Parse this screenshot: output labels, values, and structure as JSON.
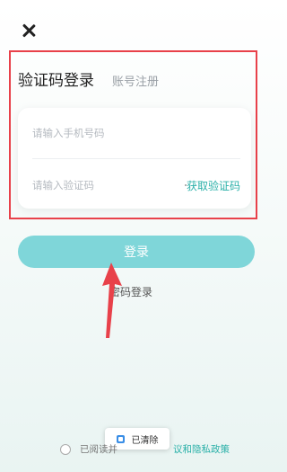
{
  "tabs": {
    "active": "验证码登录",
    "inactive": "账号注册"
  },
  "form": {
    "phone_placeholder": "请输入手机号码",
    "code_placeholder": "请输入验证码",
    "get_code_label": "获取验证码"
  },
  "buttons": {
    "login_label": "登录",
    "password_login_label": "密码登录"
  },
  "toast": {
    "text": "已清除"
  },
  "agreement": {
    "prefix": "已阅读并",
    "link_text": "议和隐私政策"
  },
  "colors": {
    "accent": "#2ab0a8",
    "button": "#7fd6d9",
    "annotation_red": "#e8414a"
  },
  "icons": {
    "close": "close-icon",
    "annotation": "red-arrow-annotation"
  }
}
